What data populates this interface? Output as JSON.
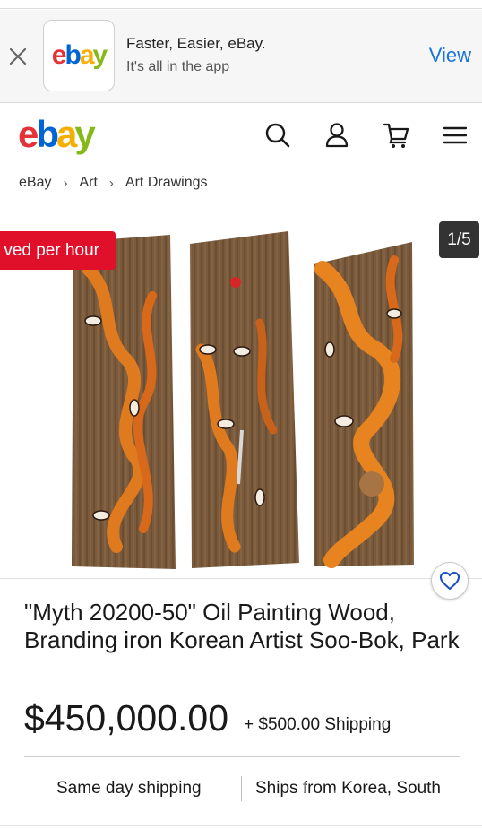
{
  "app_banner": {
    "title": "Faster, Easier, eBay.",
    "subtitle": "It's all in the app",
    "view_label": "View",
    "logo": {
      "e": "e",
      "b": "b",
      "a": "a",
      "y": "y"
    }
  },
  "header": {
    "logo": {
      "e": "e",
      "b": "b",
      "a": "a",
      "y": "y"
    },
    "icons": [
      "search-icon",
      "account-icon",
      "cart-icon",
      "menu-icon"
    ]
  },
  "breadcrumb": [
    "eBay",
    "Art",
    "Art Drawings"
  ],
  "gallery": {
    "badge": "ved per hour",
    "counter": "1/5"
  },
  "listing": {
    "title": "\"Myth 20200-50\" Oil Painting Wood, Branding iron Korean Artist Soo-Bok, Park",
    "price": "$450,000.00",
    "shipping": "+ $500.00 Shipping",
    "feature_left": "Same day shipping",
    "feature_right": "Ships from Korea, South"
  },
  "colors": {
    "accent_blue": "#1a73d9",
    "badge_red": "#e0102b",
    "logo_red": "#e53238",
    "logo_blue": "#0064d2",
    "logo_yellow": "#f5af02",
    "logo_green": "#86b817"
  }
}
